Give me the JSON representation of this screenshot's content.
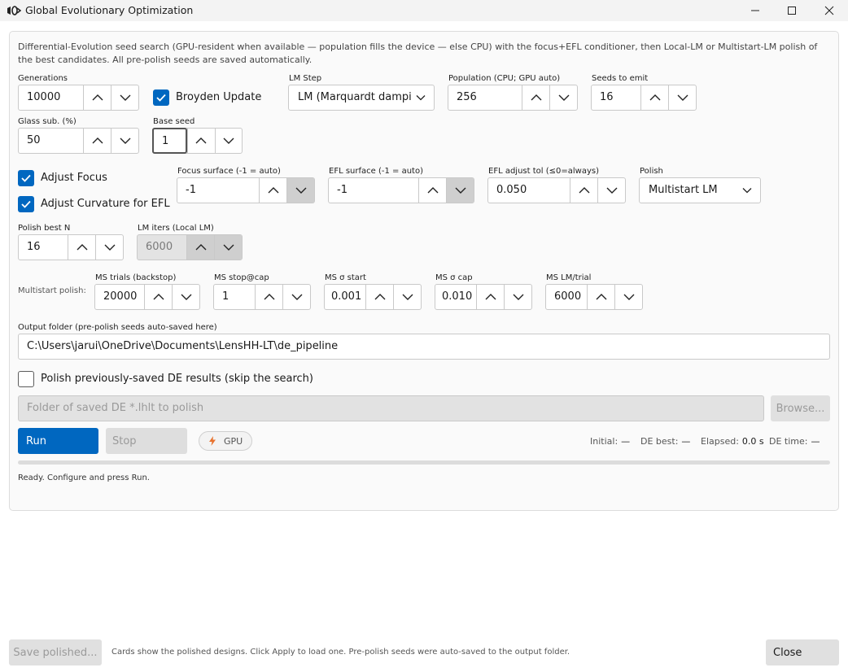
{
  "window": {
    "title": "Global Evolutionary Optimization"
  },
  "description": "Differential-Evolution seed search (GPU-resident when available — population fills the device — else CPU) with the focus+EFL conditioner, then Local-LM or Multistart-LM polish of the best candidates. All pre-polish seeds are saved automatically.",
  "fields": {
    "generations": {
      "label": "Generations",
      "value": "10000"
    },
    "broyden": {
      "label": "Broyden Update",
      "checked": true
    },
    "lm_step": {
      "label": "LM Step",
      "value": "LM (Marquardt dampi"
    },
    "population": {
      "label": "Population (CPU; GPU auto)",
      "value": "256"
    },
    "seeds_to_emit": {
      "label": "Seeds to emit",
      "value": "16"
    },
    "glass_sub": {
      "label": "Glass sub. (%)",
      "value": "50"
    },
    "base_seed": {
      "label": "Base seed",
      "value": "1"
    },
    "adjust_focus": {
      "label": "Adjust Focus",
      "checked": true
    },
    "adjust_curv": {
      "label": "Adjust Curvature for EFL",
      "checked": true
    },
    "focus_surface": {
      "label": "Focus surface (-1 = auto)",
      "value": "-1"
    },
    "efl_surface": {
      "label": "EFL surface (-1 = auto)",
      "value": "-1"
    },
    "efl_adjust_tol": {
      "label": "EFL adjust tol (≤0=always)",
      "value": "0.050"
    },
    "polish": {
      "label": "Polish",
      "value": "Multistart LM"
    },
    "polish_best_n": {
      "label": "Polish best N",
      "value": "16"
    },
    "lm_iters": {
      "label": "LM iters (Local LM)",
      "value": "6000"
    }
  },
  "multistart": {
    "label": "Multistart polish:",
    "ms_trials": {
      "label": "MS trials (backstop)",
      "value": "20000"
    },
    "ms_stop": {
      "label": "MS stop@cap",
      "value": "1"
    },
    "ms_sigma_start": {
      "label": "MS σ start",
      "value": "0.001"
    },
    "ms_sigma_cap": {
      "label": "MS σ cap",
      "value": "0.010"
    },
    "ms_lm_trial": {
      "label": "MS LM/trial",
      "value": "6000"
    }
  },
  "output": {
    "label": "Output folder (pre-polish seeds auto-saved here)",
    "value": "C:\\Users\\jarui\\OneDrive\\Documents\\LensHH-LT\\de_pipeline"
  },
  "polish_prev": {
    "label": "Polish previously-saved DE results (skip the search)",
    "checked": false
  },
  "saved_folder": {
    "placeholder": "Folder of saved DE *.lhlt to polish"
  },
  "buttons": {
    "browse": "Browse...",
    "run": "Run",
    "stop": "Stop",
    "gpu": "GPU",
    "save_polished": "Save polished...",
    "close": "Close"
  },
  "stats": {
    "initial_label": "Initial:",
    "initial_value": "—",
    "de_best_label": "DE best:",
    "de_best_value": "—",
    "elapsed_label": "Elapsed:",
    "elapsed_value": "0.0 s",
    "de_time_label": "DE time:",
    "de_time_value": "—"
  },
  "progress": 0,
  "status": "Ready. Configure and press Run.",
  "footer": "Cards show the polished designs. Click Apply to load one. Pre-polish seeds were auto-saved to the output folder.",
  "colors": {
    "accent": "#0067c0",
    "gpu_icon": "#e8712c"
  }
}
